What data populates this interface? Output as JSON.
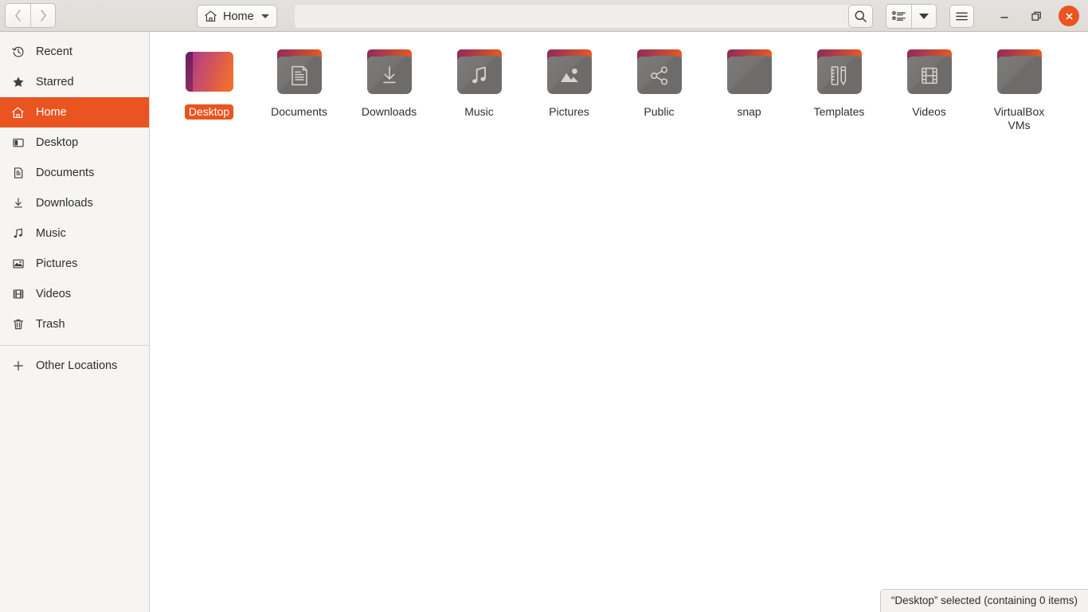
{
  "window": {
    "title": "Home",
    "controls": {
      "minimize_label": "Minimize",
      "maximize_label": "Restore",
      "close_label": "Close"
    }
  },
  "header": {
    "back_label": "Back",
    "forward_label": "Forward",
    "path_label": "Home",
    "path_icon": "home-icon",
    "search_label": "Search",
    "view_list_label": "List view",
    "view_options_label": "View options",
    "menu_label": "Main menu"
  },
  "sidebar": {
    "items": [
      {
        "label": "Recent",
        "icon": "clock-icon",
        "active": false
      },
      {
        "label": "Starred",
        "icon": "star-icon",
        "active": false
      },
      {
        "label": "Home",
        "icon": "home-icon",
        "active": true
      },
      {
        "label": "Desktop",
        "icon": "desktop-icon",
        "active": false
      },
      {
        "label": "Documents",
        "icon": "document-icon",
        "active": false
      },
      {
        "label": "Downloads",
        "icon": "download-icon",
        "active": false
      },
      {
        "label": "Music",
        "icon": "music-note-icon",
        "active": false
      },
      {
        "label": "Pictures",
        "icon": "image-icon",
        "active": false
      },
      {
        "label": "Videos",
        "icon": "film-icon",
        "active": false
      },
      {
        "label": "Trash",
        "icon": "trash-icon",
        "active": false
      }
    ],
    "other_locations": {
      "label": "Other Locations",
      "icon": "plus-icon"
    }
  },
  "files": [
    {
      "name": "Desktop",
      "type": "wallpaper",
      "glyph": "",
      "selected": true
    },
    {
      "name": "Documents",
      "type": "folder",
      "glyph": "document-icon",
      "selected": false
    },
    {
      "name": "Downloads",
      "type": "folder",
      "glyph": "download-icon",
      "selected": false
    },
    {
      "name": "Music",
      "type": "folder",
      "glyph": "music-note-icon",
      "selected": false
    },
    {
      "name": "Pictures",
      "type": "folder",
      "glyph": "image-icon",
      "selected": false
    },
    {
      "name": "Public",
      "type": "folder",
      "glyph": "share-icon",
      "selected": false
    },
    {
      "name": "snap",
      "type": "folder",
      "glyph": "",
      "selected": false
    },
    {
      "name": "Templates",
      "type": "folder",
      "glyph": "ruler-pencil-icon",
      "selected": false
    },
    {
      "name": "Videos",
      "type": "folder",
      "glyph": "film-icon",
      "selected": false
    },
    {
      "name": "VirtualBox VMs",
      "type": "folder",
      "glyph": "",
      "selected": false
    }
  ],
  "status": {
    "text": "“Desktop” selected  (containing 0 items)"
  },
  "colors": {
    "accent": "#E95420",
    "sidebar_bg": "#F6F5F4",
    "header_bg": "#E0DDD9",
    "content_bg": "#FFFFFF",
    "text": "#2E2E2E",
    "folder_body": "#767472",
    "folder_tab_start": "#8E2D56",
    "folder_tab_end": "#EF5B20"
  }
}
